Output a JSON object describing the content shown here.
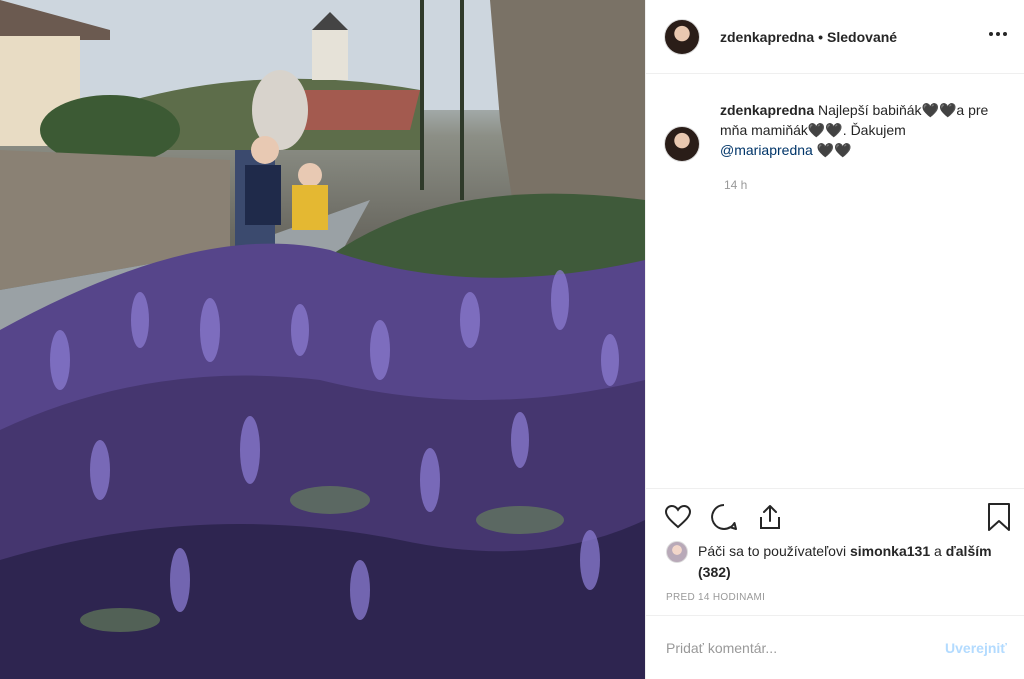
{
  "post": {
    "username": "zdenkapredna",
    "dot": "•",
    "follow_status": "Sledované",
    "caption": {
      "username": "zdenkapredna",
      "text_part1": "Najlepší babiňák",
      "hearts1": "🖤🖤",
      "text_part2": "a pre mňa mamiňák",
      "hearts2": "🖤🖤",
      "text_part3": ". Ďakujem",
      "mention": "@mariapredna",
      "hearts3": "🖤🖤",
      "time": "14 h"
    },
    "likes": {
      "prefix": "Páči sa to používateľovi",
      "user": "simonka131",
      "conj": "a",
      "others": "ďalším (382)"
    },
    "posted_ago": "PRED 14 HODINAMI",
    "comment_placeholder": "Pridať komentár...",
    "post_button": "Uverejniť"
  },
  "icons": [
    "more-options-icon",
    "heart-icon",
    "comment-icon",
    "share-icon",
    "bookmark-icon"
  ],
  "colors": {
    "mention": "#003569",
    "post_disabled": "#b3dbff",
    "muted": "#999999"
  }
}
